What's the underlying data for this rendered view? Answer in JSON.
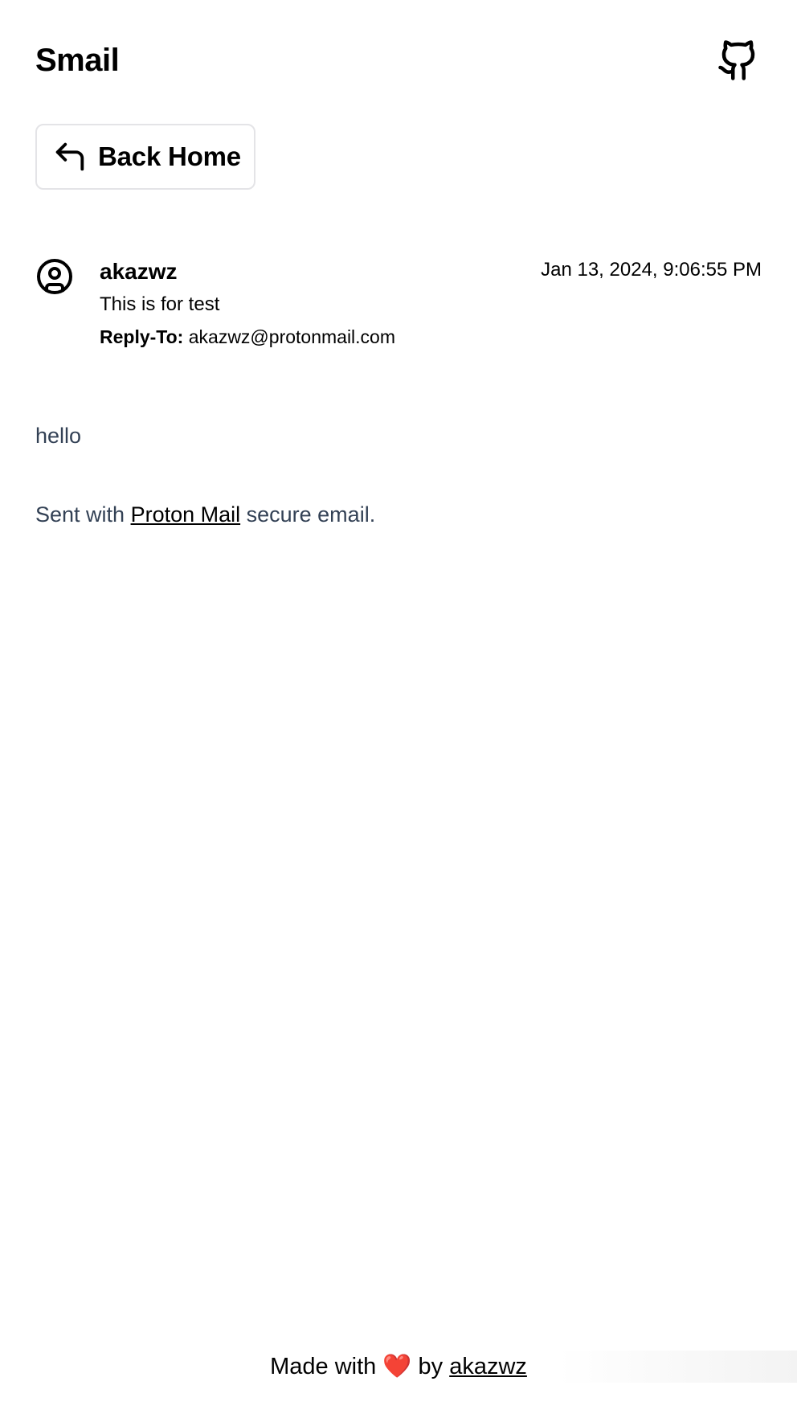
{
  "header": {
    "app_title": "Smail",
    "github_icon": "github-icon"
  },
  "back_button": {
    "icon": "reply-arrow-icon",
    "label": "Back Home"
  },
  "email": {
    "avatar_icon": "user-circle-icon",
    "sender": "akazwz",
    "subject": "This is for test",
    "reply_to_label": "Reply-To:",
    "reply_to_value": "akazwz@protonmail.com",
    "date": "Jan 13, 2024, 9:06:55 PM",
    "body": {
      "greeting": "hello",
      "sent_prefix": "Sent with ",
      "link_text": "Proton Mail",
      "sent_suffix": " secure email."
    }
  },
  "footer": {
    "made_with": "Made with",
    "heart": "❤️",
    "by": "by",
    "author_link": "akazwz"
  },
  "colors": {
    "body_text": "#334155",
    "border": "#e4e4e7",
    "heart": "#e11d2a"
  }
}
